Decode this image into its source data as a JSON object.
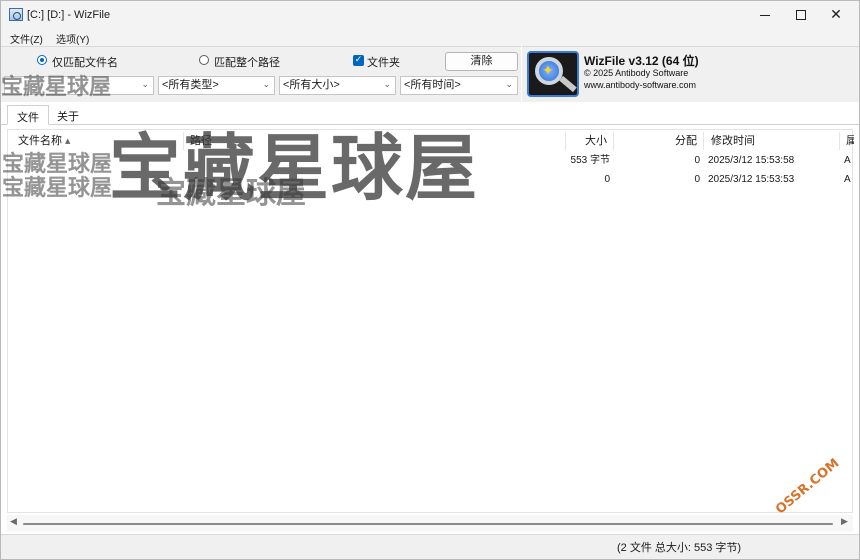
{
  "window": {
    "title": "[C:] [D:]  - WizFile",
    "minimize_glyph": "",
    "close_glyph": "✕"
  },
  "menu": {
    "file": "文件(Z)",
    "options": "选项(Y)"
  },
  "filters": {
    "radio_filename_only": "仅匹配文件名",
    "radio_full_path": "匹配整个路径",
    "checkbox_folders": "文件夹",
    "checkbox_folders_checked": true,
    "clear_button": "清除",
    "name_value": "",
    "type_value": "<所有类型>",
    "size_value": "<所有大小>",
    "time_value": "<所有时间>"
  },
  "brand": {
    "title": "WizFile v3.12 (64 位)",
    "copyright": "© 2025 Antibody Software",
    "url": "www.antibody-software.com"
  },
  "tabs": [
    {
      "label": "文件",
      "active": true
    },
    {
      "label": "关于",
      "active": false
    }
  ],
  "table": {
    "columns": {
      "name": "文件名称",
      "path": "路径",
      "size": "大小",
      "alloc": "分配",
      "modified": "修改时间",
      "attr": "属"
    },
    "rows": [
      {
        "name": "",
        "path": "",
        "size": "553 字节",
        "alloc": "0",
        "modified": "2025/3/12 15:53:58",
        "attr": "A"
      },
      {
        "name": "",
        "path": "",
        "size": "0",
        "alloc": "0",
        "modified": "2025/3/12 15:53:53",
        "attr": "A"
      }
    ]
  },
  "watermarks": {
    "text": "宝藏星球屋",
    "corner": "OSSR.COM"
  },
  "status": {
    "summary": "(2 文件  总大小: 553 字节)"
  }
}
